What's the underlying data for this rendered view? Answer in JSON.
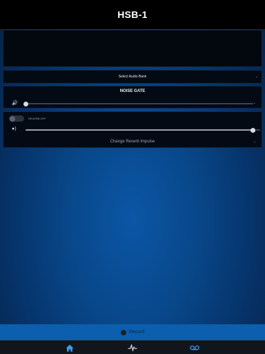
{
  "app": {
    "title": "HSB-1"
  },
  "audio_bank": {
    "label": "Select Audio Bank",
    "icon": "chevron-down-icon"
  },
  "noise_gate": {
    "label": "NOISE GATE",
    "level": 0.0
  },
  "reverb": {
    "toggle_label": "REVERB OFF",
    "enabled": false,
    "level": 0.97,
    "impulse_label": "Change Reverb Impulse"
  },
  "record": {
    "label": "Record"
  },
  "tabs": [
    {
      "name": "home",
      "icon": "home-icon",
      "active": true
    },
    {
      "name": "monitor",
      "icon": "pulse-icon",
      "active": false
    },
    {
      "name": "recordings",
      "icon": "tape-icon",
      "active": false
    }
  ],
  "colors": {
    "accent": "#0b5fae",
    "active_tab": "#3a9be8",
    "background": "#06336a"
  }
}
